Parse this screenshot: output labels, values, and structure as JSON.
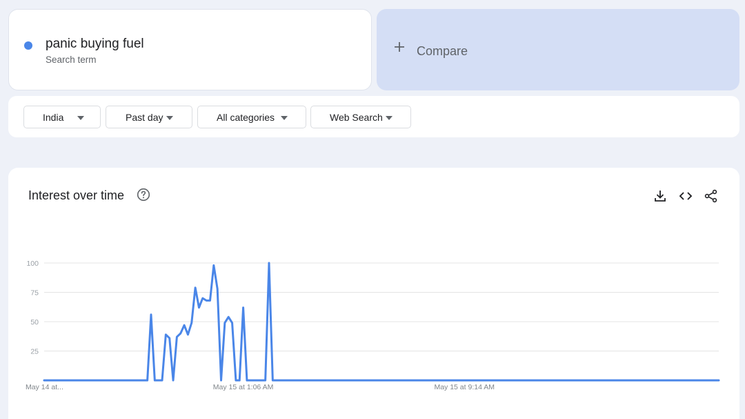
{
  "search_term": {
    "name": "panic buying fuel",
    "type": "Search term",
    "color": "#4a86e8"
  },
  "compare": {
    "icon": "plus-icon",
    "label": "Compare"
  },
  "filters": {
    "region": "India",
    "time_range": "Past day",
    "category": "All categories",
    "property": "Web Search"
  },
  "chart_section": {
    "title": "Interest over time",
    "icons": [
      "help-icon",
      "download-icon",
      "embed-code-icon",
      "share-icon"
    ]
  },
  "chart_data": {
    "type": "line",
    "title": "Interest over time",
    "ylim": [
      0,
      100
    ],
    "y_ticks": [
      25,
      50,
      75,
      100
    ],
    "x_tick_labels": [
      "May 14 at...",
      "May 15 at 1:06 AM",
      "May 15 at 9:14 AM"
    ],
    "x_tick_indices": [
      0,
      54,
      114
    ],
    "grid": true,
    "line_color": "#4a86e8",
    "series": [
      {
        "name": "panic buying fuel",
        "values": [
          0,
          0,
          0,
          0,
          0,
          0,
          0,
          0,
          0,
          0,
          0,
          0,
          0,
          0,
          0,
          0,
          0,
          0,
          0,
          0,
          0,
          0,
          0,
          0,
          0,
          0,
          0,
          0,
          0,
          56,
          0,
          0,
          0,
          39,
          36,
          0,
          37,
          40,
          47,
          39,
          49,
          79,
          62,
          70,
          68,
          68,
          98,
          78,
          0,
          49,
          54,
          49,
          0,
          0,
          62,
          0,
          0,
          0,
          0,
          0,
          0,
          100,
          0,
          0,
          0,
          0,
          0,
          0,
          0,
          0,
          0,
          0,
          0,
          0,
          0,
          0,
          0,
          0,
          0,
          0,
          0,
          0,
          0,
          0,
          0,
          0,
          0,
          0,
          0,
          0,
          0,
          0,
          0,
          0,
          0,
          0,
          0,
          0,
          0,
          0,
          0,
          0,
          0,
          0,
          0,
          0,
          0,
          0,
          0,
          0,
          0,
          0,
          0,
          0,
          0,
          0,
          0,
          0,
          0,
          0,
          0,
          0,
          0,
          0,
          0,
          0,
          0,
          0,
          0,
          0,
          0,
          0,
          0,
          0,
          0,
          0,
          0,
          0,
          0,
          0,
          0,
          0,
          0,
          0,
          0,
          0,
          0,
          0,
          0,
          0,
          0,
          0,
          0,
          0,
          0,
          0,
          0,
          0,
          0,
          0,
          0,
          0,
          0,
          0,
          0,
          0,
          0,
          0,
          0,
          0,
          0,
          0,
          0,
          0,
          0,
          0,
          0,
          0,
          0,
          0,
          0,
          0,
          0,
          0
        ]
      }
    ]
  }
}
